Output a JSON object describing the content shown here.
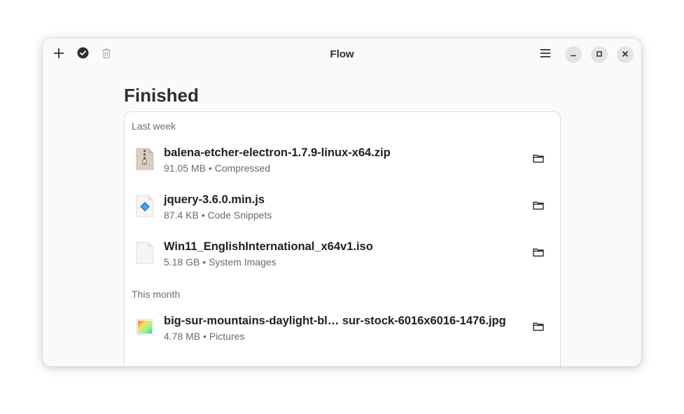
{
  "window": {
    "title": "Flow"
  },
  "headerbar": {
    "add_icon": "plus-icon",
    "select_icon": "check-circle-icon",
    "delete_icon": "trash-icon",
    "menu_icon": "hamburger-menu-icon",
    "minimize_icon": "minimize-icon",
    "maximize_icon": "maximize-icon",
    "close_icon": "close-icon"
  },
  "page": {
    "title": "Finished"
  },
  "sections": [
    {
      "label": "Last week",
      "items": [
        {
          "name": "balena-etcher-electron-1.7.9-linux-x64.zip",
          "size": "91.05 MB",
          "type": "Compressed",
          "icon": "archive-file-icon"
        },
        {
          "name": "jquery-3.6.0.min.js",
          "size": "87.4 KB",
          "type": "Code Snippets",
          "icon": "javascript-file-icon"
        },
        {
          "name": "Win11_EnglishInternational_x64v1.iso",
          "size": "5.18 GB",
          "type": "System Images",
          "icon": "generic-file-icon"
        }
      ]
    },
    {
      "label": "This month",
      "items": [
        {
          "name": "big-sur-mountains-daylight-bl… sur-stock-6016x6016-1476.jpg",
          "size": "4.78 MB",
          "type": "Pictures",
          "icon": "image-file-icon"
        }
      ]
    }
  ],
  "separator": "•",
  "colors": {
    "accent": "#3584e4",
    "text": "#2e2e2e",
    "dim": "#6e6e6e",
    "card_border": "#dedede"
  }
}
